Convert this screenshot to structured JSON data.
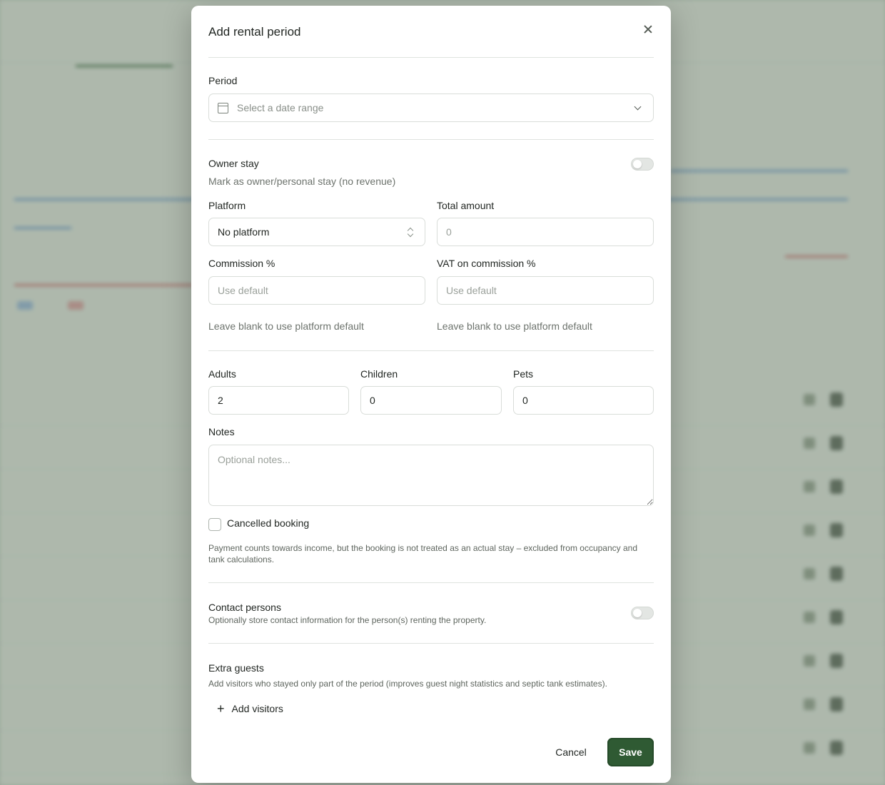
{
  "dialog": {
    "title": "Add rental period",
    "period": {
      "label": "Period",
      "placeholder": "Select a date range"
    },
    "owner_stay": {
      "label": "Owner stay",
      "description": "Mark as owner/personal stay (no revenue)",
      "enabled": false
    },
    "platform": {
      "label": "Platform",
      "value": "No platform"
    },
    "total_amount": {
      "label": "Total amount",
      "placeholder": "0"
    },
    "commission": {
      "label": "Commission %",
      "placeholder": "Use default",
      "help": "Leave blank to use platform default"
    },
    "vat_commission": {
      "label": "VAT on commission %",
      "placeholder": "Use default",
      "help": "Leave blank to use platform default"
    },
    "adults": {
      "label": "Adults",
      "value": "2"
    },
    "children": {
      "label": "Children",
      "value": "0"
    },
    "pets": {
      "label": "Pets",
      "value": "0"
    },
    "notes": {
      "label": "Notes",
      "placeholder": "Optional notes..."
    },
    "cancelled": {
      "label": "Cancelled booking",
      "checked": false,
      "description": "Payment counts towards income, but the booking is not treated as an actual stay – excluded from occupancy and tank calculations."
    },
    "contact_persons": {
      "label": "Contact persons",
      "description": "Optionally store contact information for the person(s) renting the property.",
      "enabled": false
    },
    "extra_guests": {
      "label": "Extra guests",
      "description": "Add visitors who stayed only part of the period (improves guest night statistics and septic tank estimates).",
      "add_label": "Add visitors"
    },
    "cancel_label": "Cancel",
    "save_label": "Save"
  },
  "colors": {
    "accent": "#2f5a33",
    "overlay": "#5f735f"
  }
}
